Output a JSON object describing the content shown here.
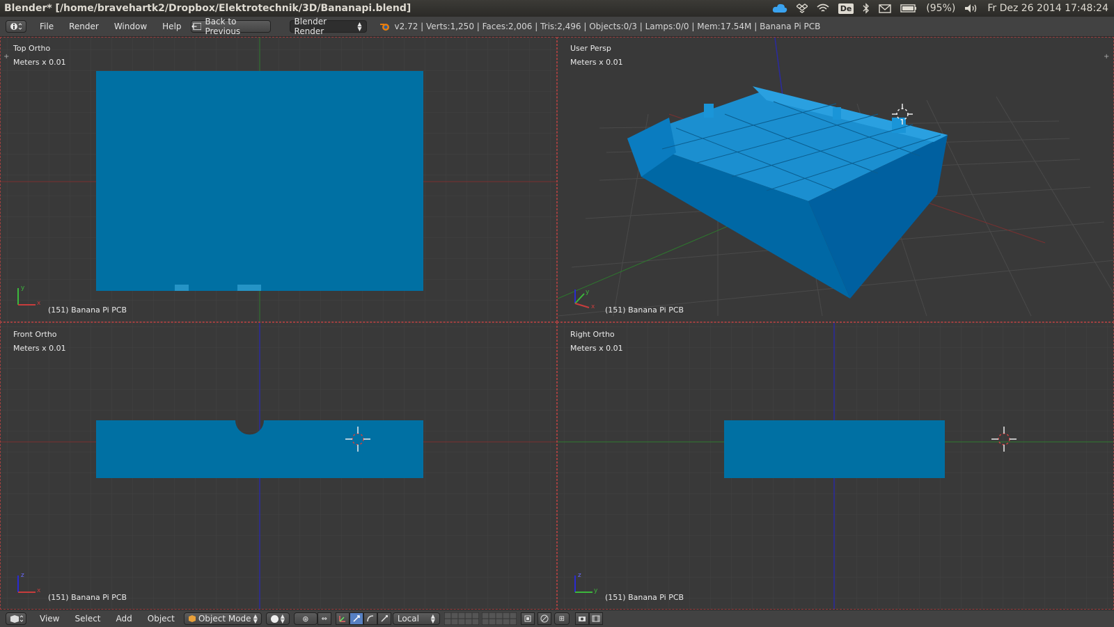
{
  "window": {
    "title": "Blender* [/home/bravehartk2/Dropbox/Elektrotechnik/3D/Bananapi.blend]",
    "keyboard_layout": "De",
    "battery": "(95%)",
    "clock": "Fr Dez 26 2014 17:48:24"
  },
  "info_header": {
    "menus": [
      "File",
      "Render",
      "Window",
      "Help"
    ],
    "back_button": "Back to Previous",
    "render_engine": "Blender Render",
    "stats": "v2.72 | Verts:1,250 | Faces:2,006 | Tris:2,496 | Objects:0/3 | Lamps:0/0 | Mem:17.54M | Banana Pi PCB"
  },
  "viewports": {
    "top": {
      "view": "Top Ortho",
      "units": "Meters x 0.01",
      "object": "(151) Banana Pi PCB",
      "axes": [
        "y",
        "x"
      ]
    },
    "persp": {
      "view": "User Persp",
      "units": "Meters x 0.01",
      "object": "(151) Banana Pi PCB",
      "axes": [
        "y",
        "x"
      ]
    },
    "front": {
      "view": "Front Ortho",
      "units": "Meters x 0.01",
      "object": "(151) Banana Pi PCB",
      "axes": [
        "z",
        "x"
      ]
    },
    "right": {
      "view": "Right Ortho",
      "units": "Meters x 0.01",
      "object": "(151) Banana Pi PCB",
      "axes": [
        "z",
        "y"
      ]
    }
  },
  "view3d_header": {
    "menus": [
      "View",
      "Select",
      "Add",
      "Object"
    ],
    "mode": "Object Mode",
    "orientation": "Local"
  },
  "colors": {
    "mesh": "#0070a3",
    "background": "#393939",
    "grid": "#454545",
    "x_axis": "#8a2e2e",
    "y_axis": "#2e7a2e",
    "z_axis": "#2a2a8a"
  }
}
